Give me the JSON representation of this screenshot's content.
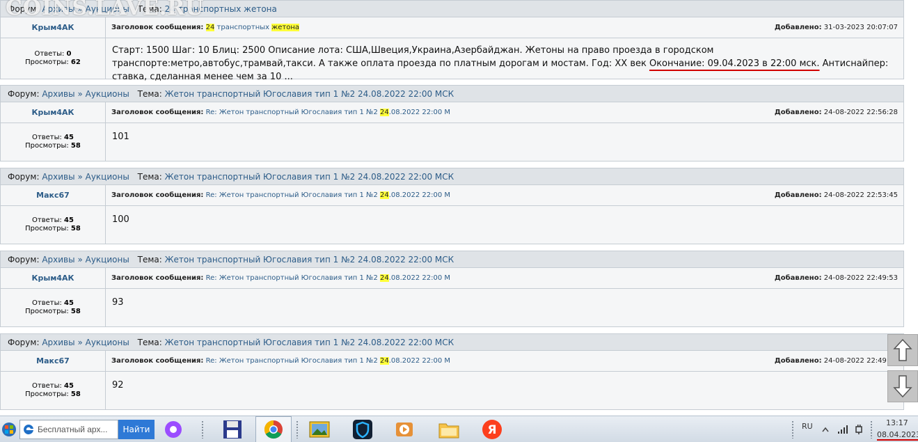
{
  "watermark": "COINS.LAVE.RU",
  "labels": {
    "forum": "Форум:",
    "tema": "Тема:",
    "subject": "Заголовок сообщения:",
    "added": "Добавлено:",
    "answers": "Ответы:",
    "views": "Просмотры:",
    "sep": "»"
  },
  "posts": [
    {
      "forum_a": "Архивы",
      "forum_b": "Аукционы",
      "topic": "24 транспортных жетона",
      "author": "Крым4АК",
      "subject_pre": "",
      "subject_hl": "24",
      "subject_mid": " транспортных ",
      "subject_hl2": "жетона",
      "subject_post": "",
      "added": "31-03-2023 20:07:07",
      "answers": "0",
      "views": "62",
      "msg_start": "Старт: 1500 Шаг: 10 Блиц: 2500 Описание лота: США,Швеция,Украина,Азербайджан. Жетоны на право проезда в городском транспорте:метро,автобус,трамвай,такси. А также оплата проезда по платным дорогам и мостам. Год: XX век ",
      "msg_underlined": "Окончание: 09.04.2023 в 22:00 мск.",
      "msg_end": " Антиснайпер: ставка, сделанная менее чем за 10 ..."
    },
    {
      "forum_a": "Архивы",
      "forum_b": "Аукционы",
      "topic": "Жетон транспортный Югославия тип 1 №2 24.08.2022 22:00 МСК",
      "author": "Крым4АК",
      "subject_pre": "Re: Жетон транспортный Югославия тип 1 №2 ",
      "subject_hl": "24",
      "subject_post": ".08.2022 22:00 М",
      "added": "24-08-2022 22:56:28",
      "answers": "45",
      "views": "58",
      "msg": "101"
    },
    {
      "forum_a": "Архивы",
      "forum_b": "Аукционы",
      "topic": "Жетон транспортный Югославия тип 1 №2 24.08.2022 22:00 МСК",
      "author": "Макс67",
      "subject_pre": "Re: Жетон транспортный Югославия тип 1 №2 ",
      "subject_hl": "24",
      "subject_post": ".08.2022 22:00 М",
      "added": "24-08-2022 22:53:45",
      "answers": "45",
      "views": "58",
      "msg": "100"
    },
    {
      "forum_a": "Архивы",
      "forum_b": "Аукционы",
      "topic": "Жетон транспортный Югославия тип 1 №2 24.08.2022 22:00 МСК",
      "author": "Крым4АК",
      "subject_pre": "Re: Жетон транспортный Югославия тип 1 №2 ",
      "subject_hl": "24",
      "subject_post": ".08.2022 22:00 М",
      "added": "24-08-2022 22:49:53",
      "answers": "45",
      "views": "58",
      "msg": "93"
    },
    {
      "forum_a": "Архивы",
      "forum_b": "Аукционы",
      "topic": "Жетон транспортный Югославия тип 1 №2 24.08.2022 22:00 МСК",
      "author": "Макс67",
      "subject_pre": "Re: Жетон транспортный Югославия тип 1 №2 ",
      "subject_hl": "24",
      "subject_post": ".08.2022 22:00 М",
      "added": "24-08-2022 22:49:36",
      "answers": "45",
      "views": "58",
      "msg": "92"
    }
  ],
  "scroll": {
    "up_icon": "arrow-up-icon",
    "down_icon": "arrow-down-icon"
  },
  "taskbar": {
    "search_placeholder": "Бесплатный арх...",
    "find_label": "Найти",
    "apps": [
      "start-orb-icon",
      "alice-icon",
      "save-floppy-icon",
      "chrome-icon",
      "photos-icon",
      "shield-app-icon",
      "media-player-icon",
      "folder-icon",
      "yandex-icon"
    ],
    "lang": "RU",
    "time": "13:17",
    "date": "08.04.2023"
  },
  "colors": {
    "link": "#2c5c88",
    "highlight": "#ffff3a",
    "underline": "#d10000",
    "header_bg": "#dfe3e7",
    "row_bg": "#f5f6f7"
  }
}
